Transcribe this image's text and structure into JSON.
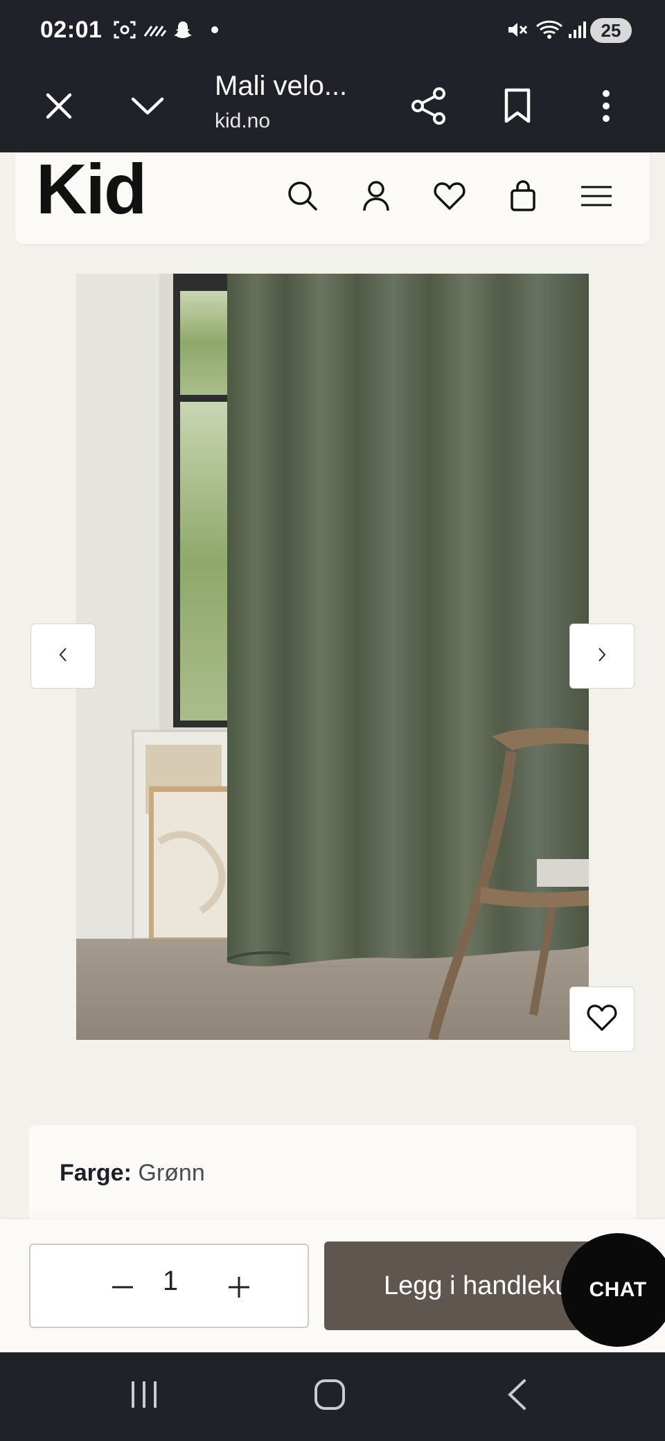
{
  "status_bar": {
    "time": "02:01",
    "battery": "25",
    "icons": [
      "screenshot-icon",
      "signal-activity-icon",
      "snapchat-icon",
      "dot-icon",
      "mute-icon",
      "wifi-icon",
      "cell-signal-icon",
      "battery-icon"
    ]
  },
  "browser": {
    "title": "Mali velo...",
    "url": "kid.no",
    "buttons": [
      "close-icon",
      "chevron-down-icon",
      "share-icon",
      "bookmark-icon",
      "more-vertical-icon"
    ]
  },
  "site_header": {
    "logo": "Kid",
    "icons": [
      "search-icon",
      "user-icon",
      "heart-icon",
      "shopping-bag-icon",
      "menu-icon"
    ]
  },
  "gallery": {
    "prev_icon": "chevron-left-icon",
    "next_icon": "chevron-right-icon",
    "favorite_icon": "heart-icon"
  },
  "product": {
    "color_label": "Farge:",
    "color_value": "Grønn"
  },
  "purchase": {
    "quantity": "1",
    "minus_symbol": "−",
    "plus_symbol": "+",
    "add_to_cart": "Legg i handlekurv",
    "chat": "CHAT"
  },
  "colors": {
    "bar_dark": "#1f2229",
    "page_bg": "#f3f1ec",
    "header_bg": "#fbfaf6",
    "cart_button": "#5f5650",
    "curtain_green": "#5a6450",
    "chat_bg": "#0a0a0a"
  }
}
